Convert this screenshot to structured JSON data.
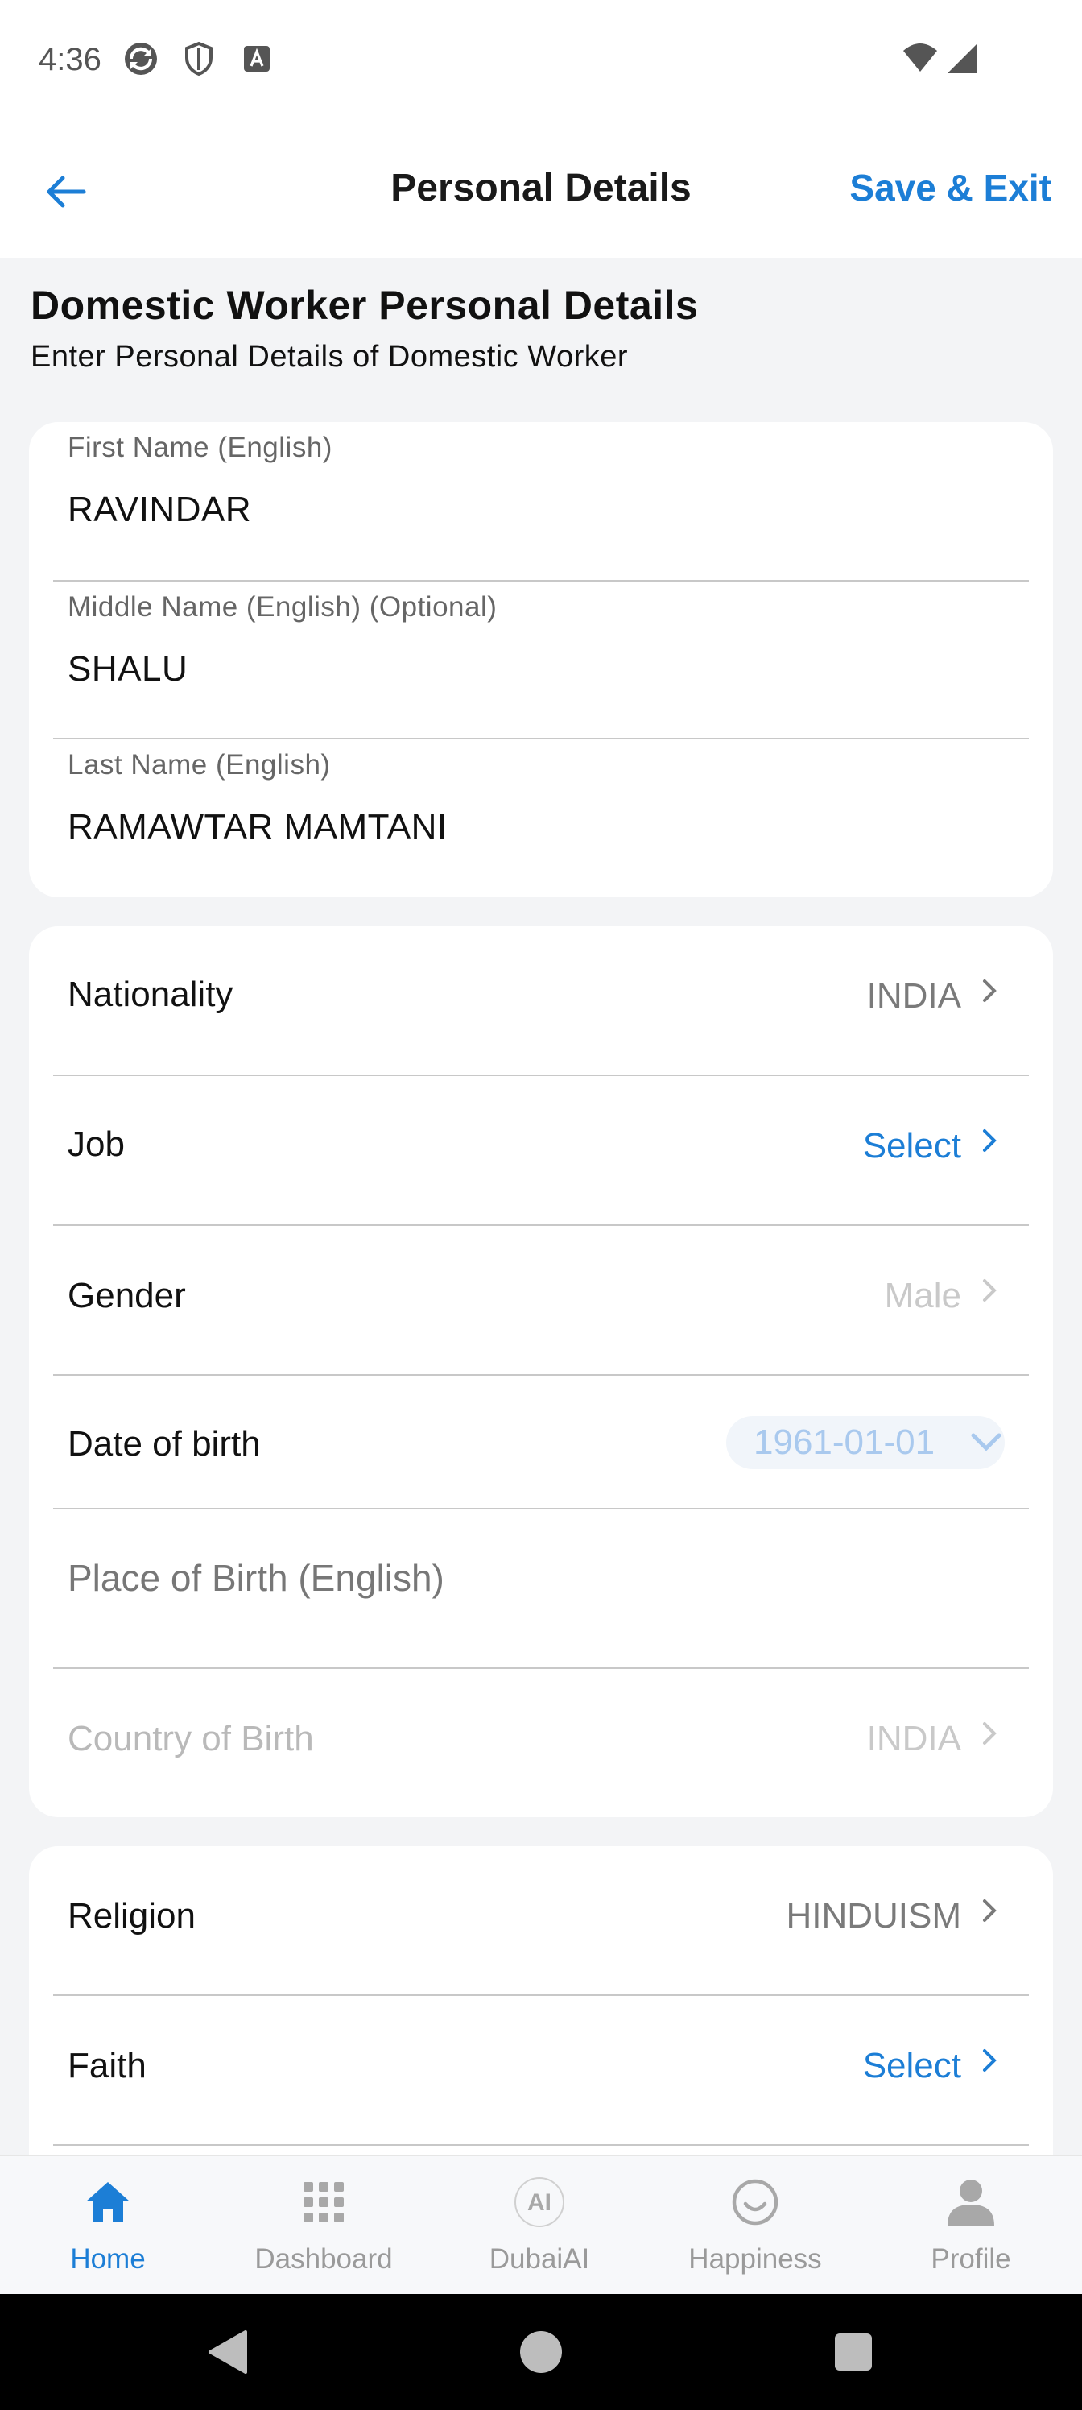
{
  "status_bar": {
    "time": "4:36",
    "icons": [
      "sync-icon",
      "shield-icon",
      "font-a-icon",
      "wifi-icon",
      "signal-icon"
    ]
  },
  "header": {
    "title": "Personal Details",
    "save_exit_label": "Save & Exit",
    "accent_color": "#1C7ED6"
  },
  "section": {
    "title": "Domestic Worker Personal Details",
    "subtitle": "Enter Personal Details of Domestic Worker"
  },
  "names": {
    "first": {
      "label": "First Name (English)",
      "value": "RAVINDAR"
    },
    "middle": {
      "label": "Middle Name (English) (Optional)",
      "value": "SHALU"
    },
    "last": {
      "label": "Last Name (English)",
      "value": "RAMAWTAR MAMTANI"
    }
  },
  "details": {
    "nationality": {
      "label": "Nationality",
      "value": "INDIA"
    },
    "job": {
      "label": "Job",
      "value": "Select"
    },
    "gender": {
      "label": "Gender",
      "value": "Male"
    },
    "dob": {
      "label": "Date of birth",
      "value": "1961-01-01"
    },
    "place_of_birth": {
      "placeholder": "Place of Birth (English)"
    },
    "country_of_birth": {
      "label": "Country of Birth",
      "value": "INDIA"
    }
  },
  "religion": {
    "religion": {
      "label": "Religion",
      "value": "HINDUISM"
    },
    "faith": {
      "label": "Faith",
      "value": "Select"
    }
  },
  "bottom_nav": {
    "items": [
      {
        "label": "Home",
        "icon": "home-icon",
        "active": true
      },
      {
        "label": "Dashboard",
        "icon": "grid-icon",
        "active": false
      },
      {
        "label": "DubaiAI",
        "icon": "ai-icon",
        "active": false
      },
      {
        "label": "Happiness",
        "icon": "smile-icon",
        "active": false
      },
      {
        "label": "Profile",
        "icon": "person-icon",
        "active": false
      }
    ]
  }
}
